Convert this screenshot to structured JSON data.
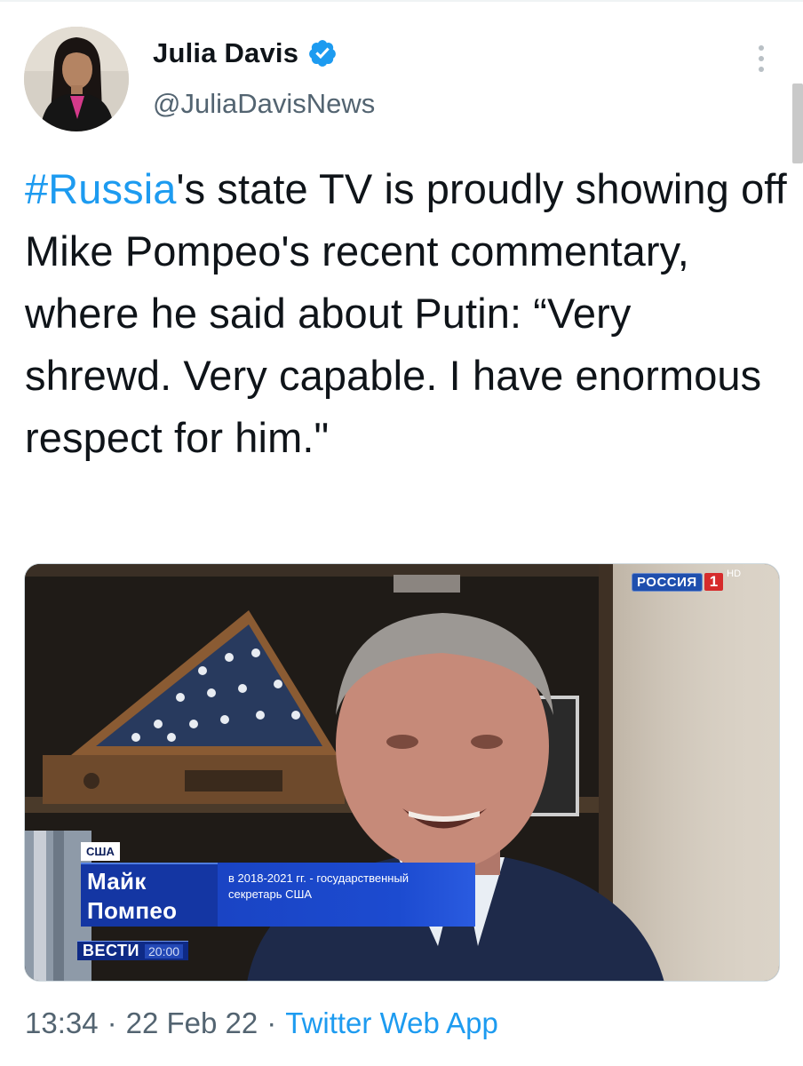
{
  "author": {
    "display_name": "Julia Davis",
    "handle": "@JuliaDavisNews",
    "verified": true
  },
  "tweet": {
    "hashtag": "#Russia",
    "text_after_hashtag": "'s state TV is proudly showing off Mike Pompeo's recent commentary, where he said about Putin: “Very shrewd. Very capable. I have enormous respect for him.\""
  },
  "media": {
    "channel_logo": "РОССИЯ",
    "channel_number": "1",
    "channel_hd": "HD",
    "country_tag": "США",
    "name_line1": "Майк",
    "name_line2": "Помпео",
    "desc_line1": "в 2018-2021 гг. - государственный",
    "desc_line2": "секретарь США",
    "program": "ВЕСТИ",
    "program_time": "20:00"
  },
  "meta": {
    "time": "13:34",
    "separator": "·",
    "date": "22 Feb 22",
    "source": "Twitter Web App"
  },
  "icons": {
    "verified": "verified-badge-icon",
    "more": "more-vertical-icon"
  },
  "colors": {
    "link": "#1d9bf0",
    "text": "#0f1419",
    "secondary": "#536471"
  }
}
